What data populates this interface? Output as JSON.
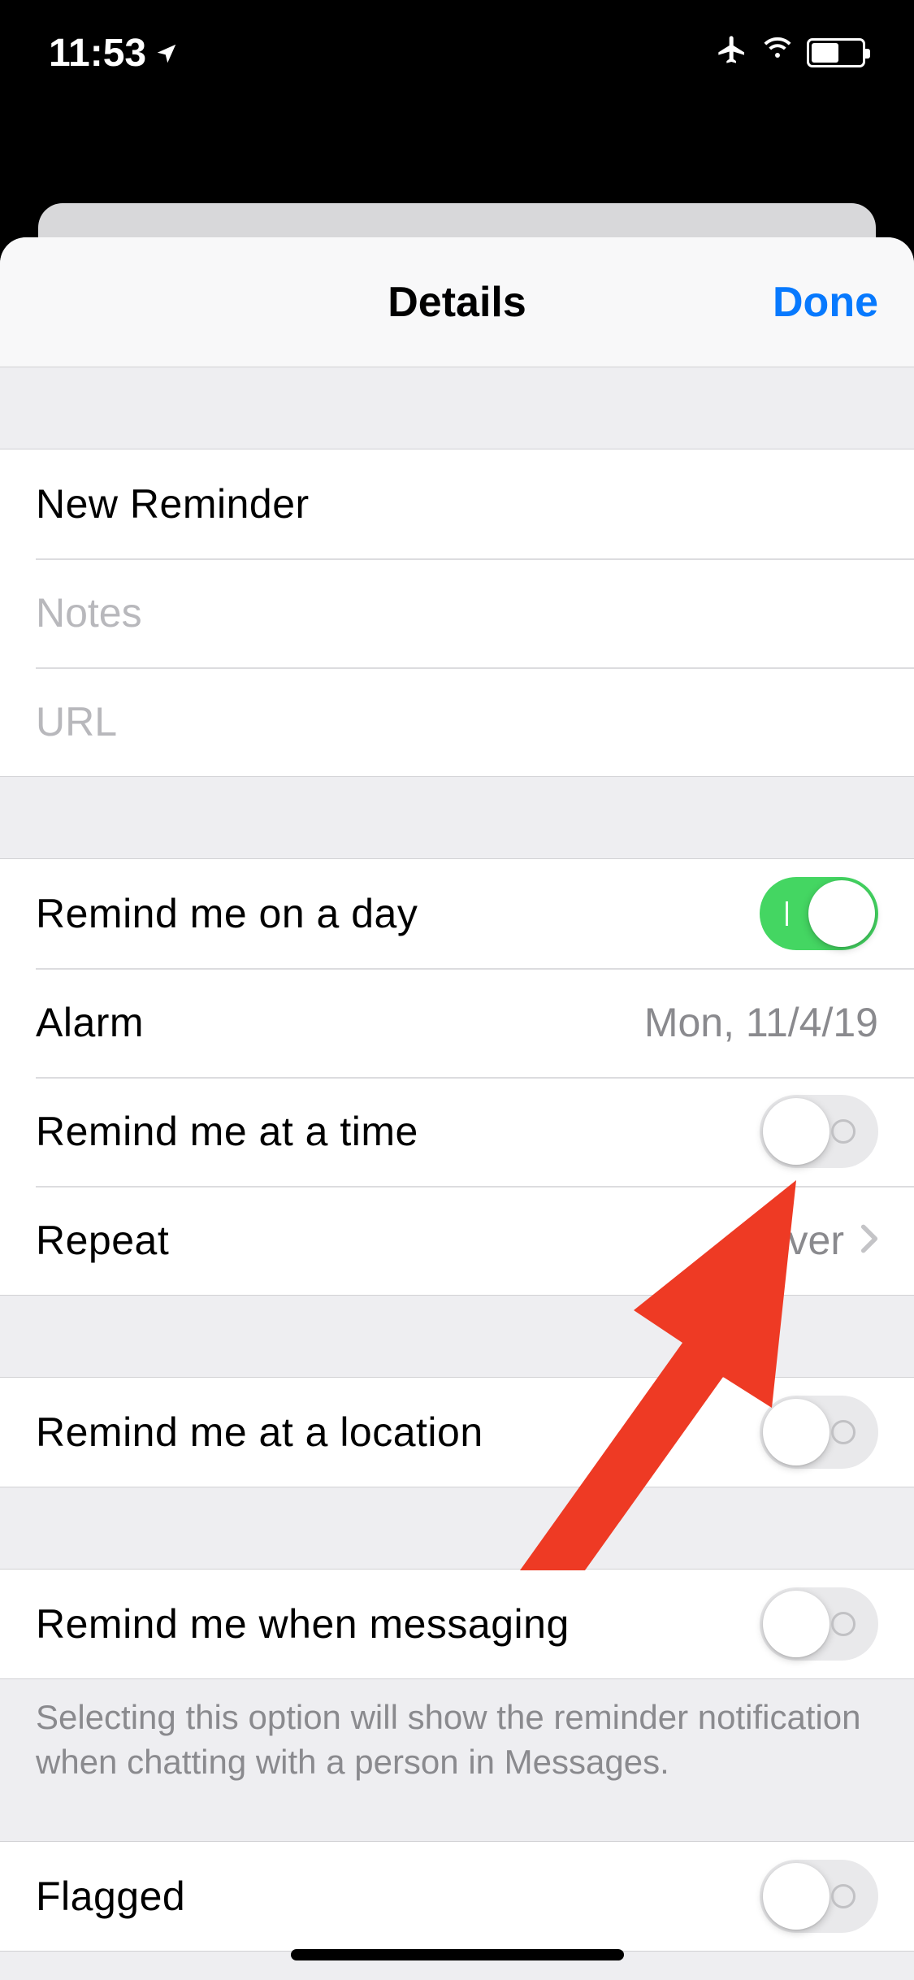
{
  "status": {
    "time": "11:53"
  },
  "nav": {
    "title": "Details",
    "done": "Done"
  },
  "section1": {
    "title_field_value": "New Reminder",
    "notes_placeholder": "Notes",
    "url_placeholder": "URL"
  },
  "section2": {
    "remind_day_label": "Remind me on a day",
    "remind_day_on": true,
    "alarm_label": "Alarm",
    "alarm_value": "Mon, 11/4/19",
    "remind_time_label": "Remind me at a time",
    "remind_time_on": false,
    "repeat_label": "Repeat",
    "repeat_value": "Never"
  },
  "section3": {
    "location_label": "Remind me at a location",
    "location_on": false
  },
  "section4": {
    "messaging_label": "Remind me when messaging",
    "messaging_on": false,
    "footer": "Selecting this option will show the reminder notification when chatting with a person in Messages."
  },
  "section5": {
    "flagged_label": "Flagged",
    "flagged_on": false
  }
}
